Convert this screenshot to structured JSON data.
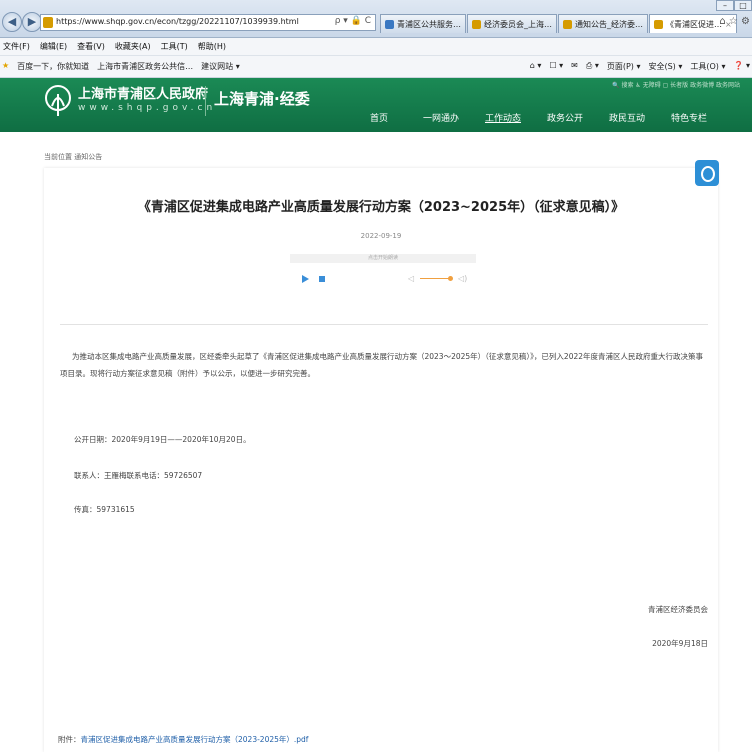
{
  "browser": {
    "url": "https://www.shqp.gov.cn/econ/tzgg/20221107/1039939.html",
    "url_tools": "ρ ▾ 🔒 C",
    "tabs": [
      {
        "label": "青浦区公共服务…",
        "icon": "blue"
      },
      {
        "label": "经济委员会_上海…",
        "icon": "gold"
      },
      {
        "label": "通知公告_经济委…",
        "icon": "gold"
      },
      {
        "label": "《青浦区促进…",
        "icon": "gold",
        "close": "×"
      }
    ],
    "window_controls": [
      "–",
      "□"
    ],
    "top_right_icons": "⌂ ☆ ⚙"
  },
  "menubar": [
    "文件(F)",
    "编辑(E)",
    "查看(V)",
    "收藏夹(A)",
    "工具(T)",
    "帮助(H)"
  ],
  "favorites": {
    "star": "★",
    "left": [
      "百度一下，你就知道",
      "上海市青浦区政务公共信…",
      "建议网站 ▾"
    ],
    "right": [
      "⌂ ▾",
      "☐ ▾",
      "✉",
      "⎙ ▾",
      "页面(P) ▾",
      "安全(S) ▾",
      "工具(O) ▾",
      "❓ ▾"
    ]
  },
  "header": {
    "site_title": "上海市青浦区人民政府",
    "site_url": "www.shqp.gov.cn",
    "dept": "上海青浦·经委",
    "util": "🔍 搜索   ♿ 无障碍   ▢ 长者版   政务微博  政务网站",
    "nav": [
      "首页",
      "一网通办",
      "工作动态",
      "政务公开",
      "政民互动",
      "特色专栏"
    ],
    "current_nav": "工作动态"
  },
  "breadcrumb": "当前位置  通知公告",
  "article": {
    "title": "《青浦区促进集成电路产业高质量发展行动方案（2023~2025年）（征求意见稿）》",
    "date": "2022-09-19",
    "player_label": "点击开始朗读",
    "paragraph": "为推动本区集成电路产业高质量发展，区经委牵头起草了《青浦区促进集成电路产业高质量发展行动方案（2023～2025年）（征求意见稿）》，已列入2022年度青浦区人民政府重大行政决策事项目录。现将行动方案征求意见稿（附件）予以公示，以便进一步研究完善。",
    "period": "公开日期：2020年9月19日——2020年10月20日。",
    "contact": "联系人：王雁梅联系电话：59726507",
    "fax": "传真：59731615",
    "signature": "青浦区经济委员会",
    "sign_date": "2020年9月18日",
    "attachment_label": "附件：",
    "attachment_link": "青浦区促进集成电路产业高质量发展行动方案（2023-2025年）.pdf"
  }
}
